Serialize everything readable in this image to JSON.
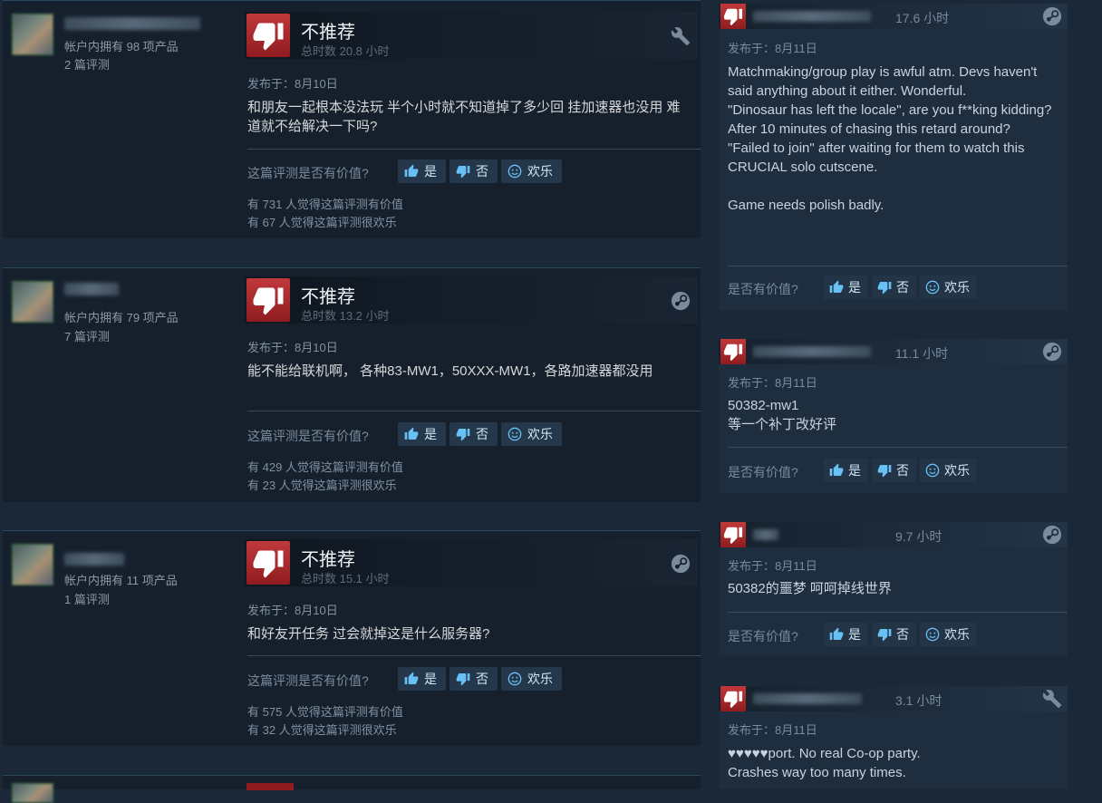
{
  "left_reviews": [
    {
      "owned": "帐户内拥有 98 项产品",
      "reviews": "2 篇评测",
      "verdict": "不推荐",
      "hours": "总时数 20.8 小时",
      "posted": "发布于：8月10日",
      "text": "和朋友一起根本没法玩 半个小时就不知道掉了多少回 挂加速器也没用 难道就不给解决一下吗?",
      "helpful_q": "这篇评测是否有价值?",
      "btn_yes": "是",
      "btn_no": "否",
      "btn_funny": "欢乐",
      "helpful_count": "有 731 人觉得这篇评测有价值",
      "funny_count": "有 67 人觉得这篇评测很欢乐",
      "corner_icon": "wrench-icon"
    },
    {
      "owned": "帐户内拥有 79 项产品",
      "reviews": "7 篇评测",
      "verdict": "不推荐",
      "hours": "总时数 13.2 小时",
      "posted": "发布于：8月10日",
      "text": "能不能给联机啊， 各种83-MW1，50XXX-MW1，各路加速器都没用",
      "helpful_q": "这篇评测是否有价值?",
      "btn_yes": "是",
      "btn_no": "否",
      "btn_funny": "欢乐",
      "helpful_count": "有 429 人觉得这篇评测有价值",
      "funny_count": "有 23 人觉得这篇评测很欢乐",
      "corner_icon": "steam-icon"
    },
    {
      "owned": "帐户内拥有 11 项产品",
      "reviews": "1 篇评测",
      "verdict": "不推荐",
      "hours": "总时数 15.1 小时",
      "posted": "发布于：8月10日",
      "text": "和好友开任务 过会就掉这是什么服务器?",
      "helpful_q": "这篇评测是否有价值?",
      "btn_yes": "是",
      "btn_no": "否",
      "btn_funny": "欢乐",
      "helpful_count": "有 575 人觉得这篇评测有价值",
      "funny_count": "有 32 人觉得这篇评测很欢乐",
      "corner_icon": "steam-icon"
    }
  ],
  "right_reviews": [
    {
      "hours": "17.6 小时",
      "posted": "发布于：8月11日",
      "text": "Matchmaking/group play is awful atm. Devs haven't said anything about it either. Wonderful.\n\"Dinosaur has left the locale\", are you f**king kidding? After 10 minutes of chasing this retard around?\n\"Failed to join\" after waiting for them to watch this CRUCIAL solo cutscene.\n\nGame needs polish badly.",
      "helpful_q": "是否有价值?",
      "btn_yes": "是",
      "btn_no": "否",
      "btn_funny": "欢乐",
      "corner_icon": "steam-icon"
    },
    {
      "hours": "11.1 小时",
      "posted": "发布于：8月11日",
      "text": "50382-mw1\n等一个补丁改好评",
      "helpful_q": "是否有价值?",
      "btn_yes": "是",
      "btn_no": "否",
      "btn_funny": "欢乐",
      "corner_icon": "steam-icon"
    },
    {
      "hours": "9.7 小时",
      "posted": "发布于：8月11日",
      "text": "50382的噩梦 呵呵掉线世界",
      "helpful_q": "是否有价值?",
      "btn_yes": "是",
      "btn_no": "否",
      "btn_funny": "欢乐",
      "corner_icon": "steam-icon"
    },
    {
      "hours": "3.1 小时",
      "posted": "发布于：8月11日",
      "text": "♥♥♥♥♥port. No real Co-op party.\nCrashes way too many times.",
      "corner_icon": "wrench-icon"
    }
  ]
}
